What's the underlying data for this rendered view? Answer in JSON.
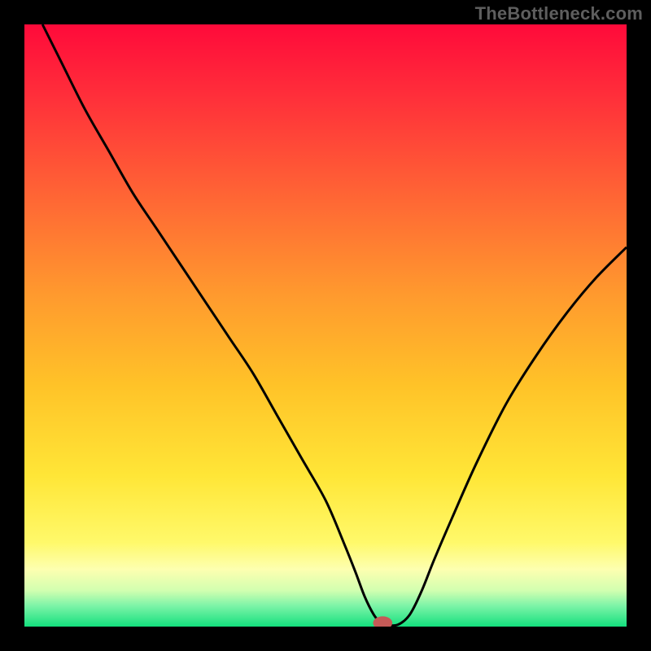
{
  "watermark": "TheBottleneck.com",
  "chart_data": {
    "type": "line",
    "title": "",
    "xlabel": "",
    "ylabel": "",
    "xlim": [
      0,
      100
    ],
    "ylim": [
      0,
      100
    ],
    "grid": false,
    "legend": false,
    "background": {
      "type": "vertical-gradient",
      "stops": [
        {
          "pos": 0.0,
          "color": "#ff0a3a"
        },
        {
          "pos": 0.12,
          "color": "#ff2f3a"
        },
        {
          "pos": 0.3,
          "color": "#ff6a34"
        },
        {
          "pos": 0.45,
          "color": "#ff9a2e"
        },
        {
          "pos": 0.6,
          "color": "#ffc328"
        },
        {
          "pos": 0.75,
          "color": "#ffe637"
        },
        {
          "pos": 0.86,
          "color": "#fff96a"
        },
        {
          "pos": 0.905,
          "color": "#fdffb0"
        },
        {
          "pos": 0.94,
          "color": "#d2ffb0"
        },
        {
          "pos": 0.965,
          "color": "#7ef4a8"
        },
        {
          "pos": 1.0,
          "color": "#14e07e"
        }
      ]
    },
    "series": [
      {
        "name": "bottleneck-curve",
        "color": "#000000",
        "stroke_width": 3,
        "x": [
          3,
          6,
          10,
          14,
          18,
          22,
          26,
          30,
          34,
          38,
          42,
          46,
          50,
          53,
          55,
          56.5,
          58,
          59,
          60,
          62,
          64,
          66,
          68,
          71,
          75,
          80,
          85,
          90,
          95,
          100
        ],
        "y": [
          100,
          94,
          86,
          79,
          72,
          66,
          60,
          54,
          48,
          42,
          35,
          28,
          21,
          14,
          9,
          5,
          2,
          0.8,
          0.3,
          0.3,
          2,
          6,
          11,
          18,
          27,
          37,
          45,
          52,
          58,
          63
        ]
      }
    ],
    "marker": {
      "name": "min-point-marker",
      "x": 59.5,
      "y": 0.6,
      "rx": 1.6,
      "ry": 1.1,
      "fill": "#c55a57"
    }
  }
}
